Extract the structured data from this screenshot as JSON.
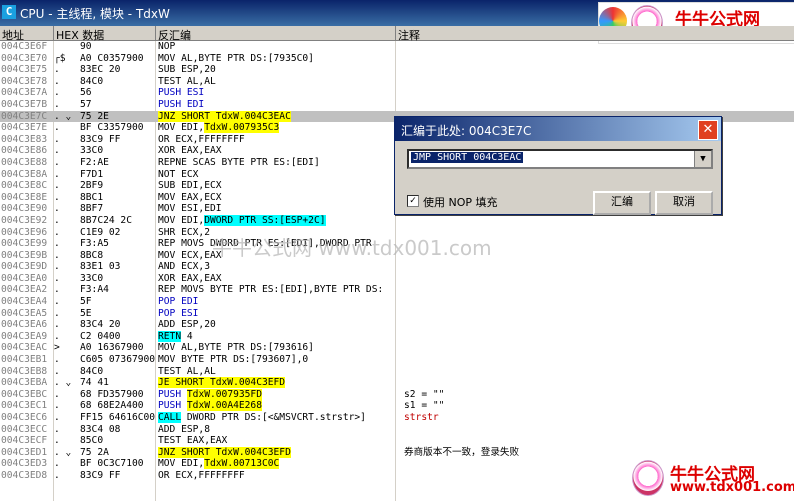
{
  "window": {
    "title": "CPU - 主线程, 模块 - TdxW",
    "icon": "C"
  },
  "header": {
    "addr": "地址",
    "hex": "HEX 数据",
    "dis": "反汇编",
    "comment": "注释"
  },
  "watermark": {
    "name": "牛牛公式网",
    "url": "www.tdx001.com",
    "center": "牛牛公式网  www.tdx001.com"
  },
  "rows": [
    {
      "addr": "004C3E6F",
      "mark": "",
      "hex": "90",
      "dis": [
        {
          "t": "NOP"
        }
      ]
    },
    {
      "addr": "004C3E70",
      "mark": "┌$",
      "hex": "A0 C0357900",
      "dis": [
        {
          "t": "MOV AL,BYTE PTR DS:[7935C0]"
        }
      ]
    },
    {
      "addr": "004C3E75",
      "mark": ".",
      "hex": "83EC 20",
      "dis": [
        {
          "t": "SUB ESP,20"
        }
      ]
    },
    {
      "addr": "004C3E78",
      "mark": ".",
      "hex": "84C0",
      "dis": [
        {
          "t": "TEST AL,AL"
        }
      ]
    },
    {
      "addr": "004C3E7A",
      "mark": ".",
      "hex": "56",
      "dis": [
        {
          "t": "PUSH ESI",
          "c": "blue"
        }
      ]
    },
    {
      "addr": "004C3E7B",
      "mark": ".",
      "hex": "57",
      "dis": [
        {
          "t": "PUSH EDI",
          "c": "blue"
        }
      ]
    },
    {
      "addr": "004C3E7C",
      "mark": ".  ⌄",
      "hex": "75 2E",
      "sel": true,
      "dis": [
        {
          "t": "JNZ SHORT TdxW.004C3EAC",
          "h": "y"
        }
      ]
    },
    {
      "addr": "004C3E7E",
      "mark": ".",
      "hex": "BF C3357900",
      "dis": [
        {
          "t": "MOV EDI,"
        },
        {
          "t": "TdxW.007935C3",
          "h": "y"
        }
      ]
    },
    {
      "addr": "004C3E83",
      "mark": ".",
      "hex": "83C9 FF",
      "dis": [
        {
          "t": "OR ECX,FFFFFFFF"
        }
      ]
    },
    {
      "addr": "004C3E86",
      "mark": ".",
      "hex": "33C0",
      "dis": [
        {
          "t": "XOR EAX,EAX"
        }
      ]
    },
    {
      "addr": "004C3E88",
      "mark": ".",
      "hex": "F2:AE",
      "dis": [
        {
          "t": "REPNE SCAS BYTE PTR ES:[EDI]"
        }
      ]
    },
    {
      "addr": "004C3E8A",
      "mark": ".",
      "hex": "F7D1",
      "dis": [
        {
          "t": "NOT ECX"
        }
      ]
    },
    {
      "addr": "004C3E8C",
      "mark": ".",
      "hex": "2BF9",
      "dis": [
        {
          "t": "SUB EDI,ECX"
        }
      ]
    },
    {
      "addr": "004C3E8E",
      "mark": ".",
      "hex": "8BC1",
      "dis": [
        {
          "t": "MOV EAX,ECX"
        }
      ]
    },
    {
      "addr": "004C3E90",
      "mark": ".",
      "hex": "8BF7",
      "dis": [
        {
          "t": "MOV ESI,EDI"
        }
      ]
    },
    {
      "addr": "004C3E92",
      "mark": ".",
      "hex": "8B7C24 2C",
      "dis": [
        {
          "t": "MOV EDI,"
        },
        {
          "t": "DWORD PTR SS:[ESP+2C]",
          "h": "c"
        }
      ]
    },
    {
      "addr": "004C3E96",
      "mark": ".",
      "hex": "C1E9 02",
      "dis": [
        {
          "t": "SHR ECX,2"
        }
      ]
    },
    {
      "addr": "004C3E99",
      "mark": ".",
      "hex": "F3:A5",
      "dis": [
        {
          "t": "REP MOVS DWORD PTR ES:[EDI],DWORD PTR"
        }
      ]
    },
    {
      "addr": "004C3E9B",
      "mark": ".",
      "hex": "8BC8",
      "dis": [
        {
          "t": "MOV ECX,EAX"
        }
      ]
    },
    {
      "addr": "004C3E9D",
      "mark": ".",
      "hex": "83E1 03",
      "dis": [
        {
          "t": "AND ECX,3"
        }
      ]
    },
    {
      "addr": "004C3EA0",
      "mark": ".",
      "hex": "33C0",
      "dis": [
        {
          "t": "XOR EAX,EAX"
        }
      ]
    },
    {
      "addr": "004C3EA2",
      "mark": ".",
      "hex": "F3:A4",
      "dis": [
        {
          "t": "REP MOVS BYTE PTR ES:[EDI],BYTE PTR DS:"
        }
      ]
    },
    {
      "addr": "004C3EA4",
      "mark": ".",
      "hex": "5F",
      "dis": [
        {
          "t": "POP EDI",
          "c": "blue"
        }
      ]
    },
    {
      "addr": "004C3EA5",
      "mark": ".",
      "hex": "5E",
      "dis": [
        {
          "t": "POP ESI",
          "c": "blue"
        }
      ]
    },
    {
      "addr": "004C3EA6",
      "mark": ".",
      "hex": "83C4 20",
      "dis": [
        {
          "t": "ADD ESP,20"
        }
      ]
    },
    {
      "addr": "004C3EA9",
      "mark": ".",
      "hex": "C2 0400",
      "dis": [
        {
          "t": "RETN",
          "h": "c"
        },
        {
          "t": " 4"
        }
      ]
    },
    {
      "addr": "004C3EAC",
      "mark": ">",
      "hex": "A0 16367900",
      "dis": [
        {
          "t": "MOV AL,BYTE PTR DS:[793616]"
        }
      ]
    },
    {
      "addr": "004C3EB1",
      "mark": ".",
      "hex": "C605 07367900",
      "dis": [
        {
          "t": "MOV BYTE PTR DS:[793607],0"
        }
      ]
    },
    {
      "addr": "004C3EB8",
      "mark": ".",
      "hex": "84C0",
      "dis": [
        {
          "t": "TEST AL,AL"
        }
      ]
    },
    {
      "addr": "004C3EBA",
      "mark": ".  ⌄",
      "hex": "74 41",
      "dis": [
        {
          "t": "JE SHORT TdxW.004C3EFD",
          "h": "y"
        }
      ]
    },
    {
      "addr": "004C3EBC",
      "mark": ".",
      "hex": "68 FD357900",
      "dis": [
        {
          "t": "PUSH ",
          "c": "blue"
        },
        {
          "t": "TdxW.007935FD",
          "h": "y"
        }
      ],
      "com": "s2 = \"\""
    },
    {
      "addr": "004C3EC1",
      "mark": ".",
      "hex": "68 68E2A400",
      "dis": [
        {
          "t": "PUSH ",
          "c": "blue"
        },
        {
          "t": "TdxW.00A4E268",
          "h": "y"
        }
      ],
      "com": "s1 = \"\""
    },
    {
      "addr": "004C3EC6",
      "mark": ".",
      "hex": "FF15 64616C00",
      "dis": [
        {
          "t": "CALL",
          "h": "c"
        },
        {
          "t": " DWORD PTR DS:[<&MSVCRT.strstr>]"
        }
      ],
      "com": "strstr",
      "comRed": true
    },
    {
      "addr": "004C3ECC",
      "mark": ".",
      "hex": "83C4 08",
      "dis": [
        {
          "t": "ADD ESP,8"
        }
      ]
    },
    {
      "addr": "004C3ECF",
      "mark": ".",
      "hex": "85C0",
      "dis": [
        {
          "t": "TEST EAX,EAX"
        }
      ]
    },
    {
      "addr": "004C3ED1",
      "mark": ".  ⌄",
      "hex": "75 2A",
      "dis": [
        {
          "t": "JNZ SHORT TdxW.004C3EFD",
          "h": "y"
        }
      ],
      "com": "券商版本不一致，登录失败"
    },
    {
      "addr": "004C3ED3",
      "mark": ".",
      "hex": "BF 0C3C7100",
      "dis": [
        {
          "t": "MOV EDI,"
        },
        {
          "t": "TdxW.00713C0C",
          "h": "y"
        }
      ]
    },
    {
      "addr": "004C3ED8",
      "mark": ".",
      "hex": "83C9 FF",
      "dis": [
        {
          "t": "OR ECX,FFFFFFFF"
        }
      ]
    }
  ],
  "dialog": {
    "title": "汇编于此处: 004C3E7C",
    "input_value": "JMP SHORT 004C3EAC",
    "checkbox_label": "使用 NOP 填充",
    "checkbox_checked": true,
    "assemble_label": "汇编",
    "cancel_label": "取消"
  }
}
